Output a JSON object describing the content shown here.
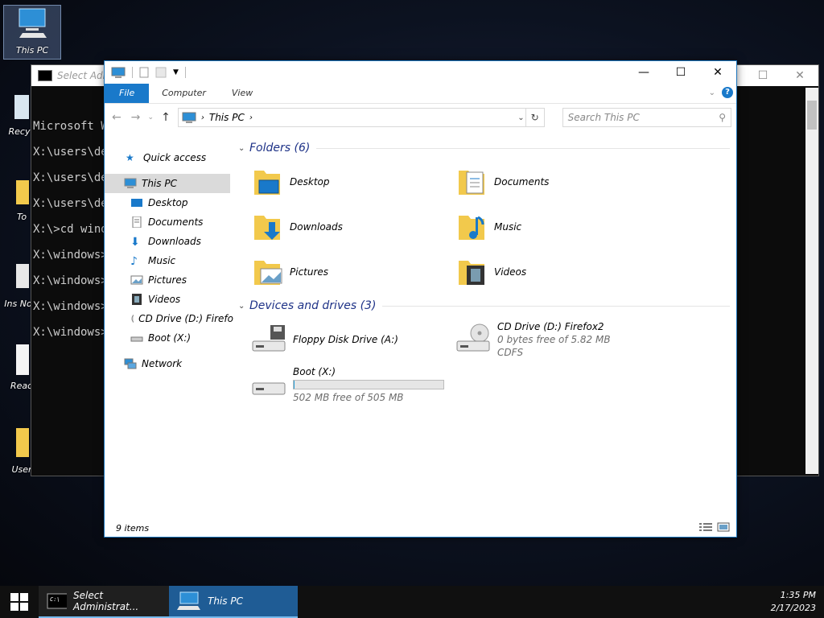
{
  "desktop": {
    "icons": [
      {
        "label": "This PC"
      },
      {
        "label": "Recyc"
      },
      {
        "label": "To"
      },
      {
        "label": "Ins Now"
      },
      {
        "label": "Read"
      },
      {
        "label": "User"
      }
    ]
  },
  "cmd": {
    "title": "Select Admi",
    "lines": [
      "Microsoft W",
      "X:\\users\\de",
      "X:\\users\\de",
      "X:\\users\\de",
      "X:\\>cd windo",
      "X:\\windows>",
      "X:\\windows>",
      "X:\\windows>",
      "X:\\windows>"
    ]
  },
  "explorer": {
    "ribbon": {
      "file": "File",
      "computer": "Computer",
      "view": "View"
    },
    "address": {
      "location": "This PC"
    },
    "search": {
      "placeholder": "Search This PC"
    },
    "nav": {
      "quick_access": "Quick access",
      "this_pc": "This PC",
      "desktop": "Desktop",
      "documents": "Documents",
      "downloads": "Downloads",
      "music": "Music",
      "pictures": "Pictures",
      "videos": "Videos",
      "cd_drive": "CD Drive (D:) Firefo",
      "boot": "Boot (X:)",
      "network": "Network"
    },
    "folders_group": "Folders (6)",
    "folders": [
      "Desktop",
      "Documents",
      "Downloads",
      "Music",
      "Pictures",
      "Videos"
    ],
    "drives_group": "Devices and drives (3)",
    "drives": {
      "floppy": {
        "name": "Floppy Disk Drive (A:)"
      },
      "cd": {
        "name": "CD Drive (D:) Firefox2",
        "free": "0 bytes free of 5.82 MB",
        "fs": "CDFS"
      },
      "boot": {
        "name": "Boot (X:)",
        "free": "502 MB free of 505 MB",
        "used_fraction": 0.006
      }
    },
    "status": "9 items"
  },
  "taskbar": {
    "cmd_label": "Select Administrat...",
    "pc_label": "This PC",
    "time": "1:35 PM",
    "date": "2/17/2023"
  },
  "colors": {
    "accent": "#1979ca",
    "group_header": "#1e3287",
    "folder": "#f2c94c"
  }
}
